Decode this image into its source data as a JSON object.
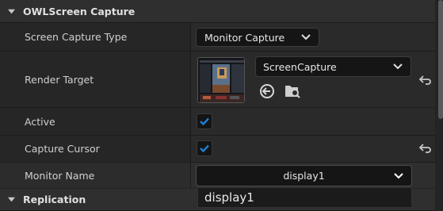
{
  "sections": {
    "owl": {
      "title": "OWLScreen Capture"
    },
    "replication": {
      "title": "Replication"
    }
  },
  "properties": {
    "screen_capture_type": {
      "label": "Screen Capture Type",
      "value": "Monitor Capture"
    },
    "render_target": {
      "label": "Render Target",
      "value": "ScreenCapture"
    },
    "active": {
      "label": "Active",
      "checked": true
    },
    "capture_cursor": {
      "label": "Capture Cursor",
      "checked": true
    },
    "monitor_name": {
      "label": "Monitor Name",
      "value": "display1"
    }
  },
  "monitor_dropdown_options": [
    "display1"
  ],
  "icons": {
    "collapse": "triangle-down-icon",
    "chevron": "chevron-down-icon",
    "reset": "reset-arrow-icon",
    "use_selected": "arrow-left-circle-icon",
    "browse": "folder-search-icon",
    "checkmark": "checkmark-icon"
  },
  "colors": {
    "accent": "#1f7fd8",
    "panel": "#242424",
    "header": "#2f2f2f"
  }
}
